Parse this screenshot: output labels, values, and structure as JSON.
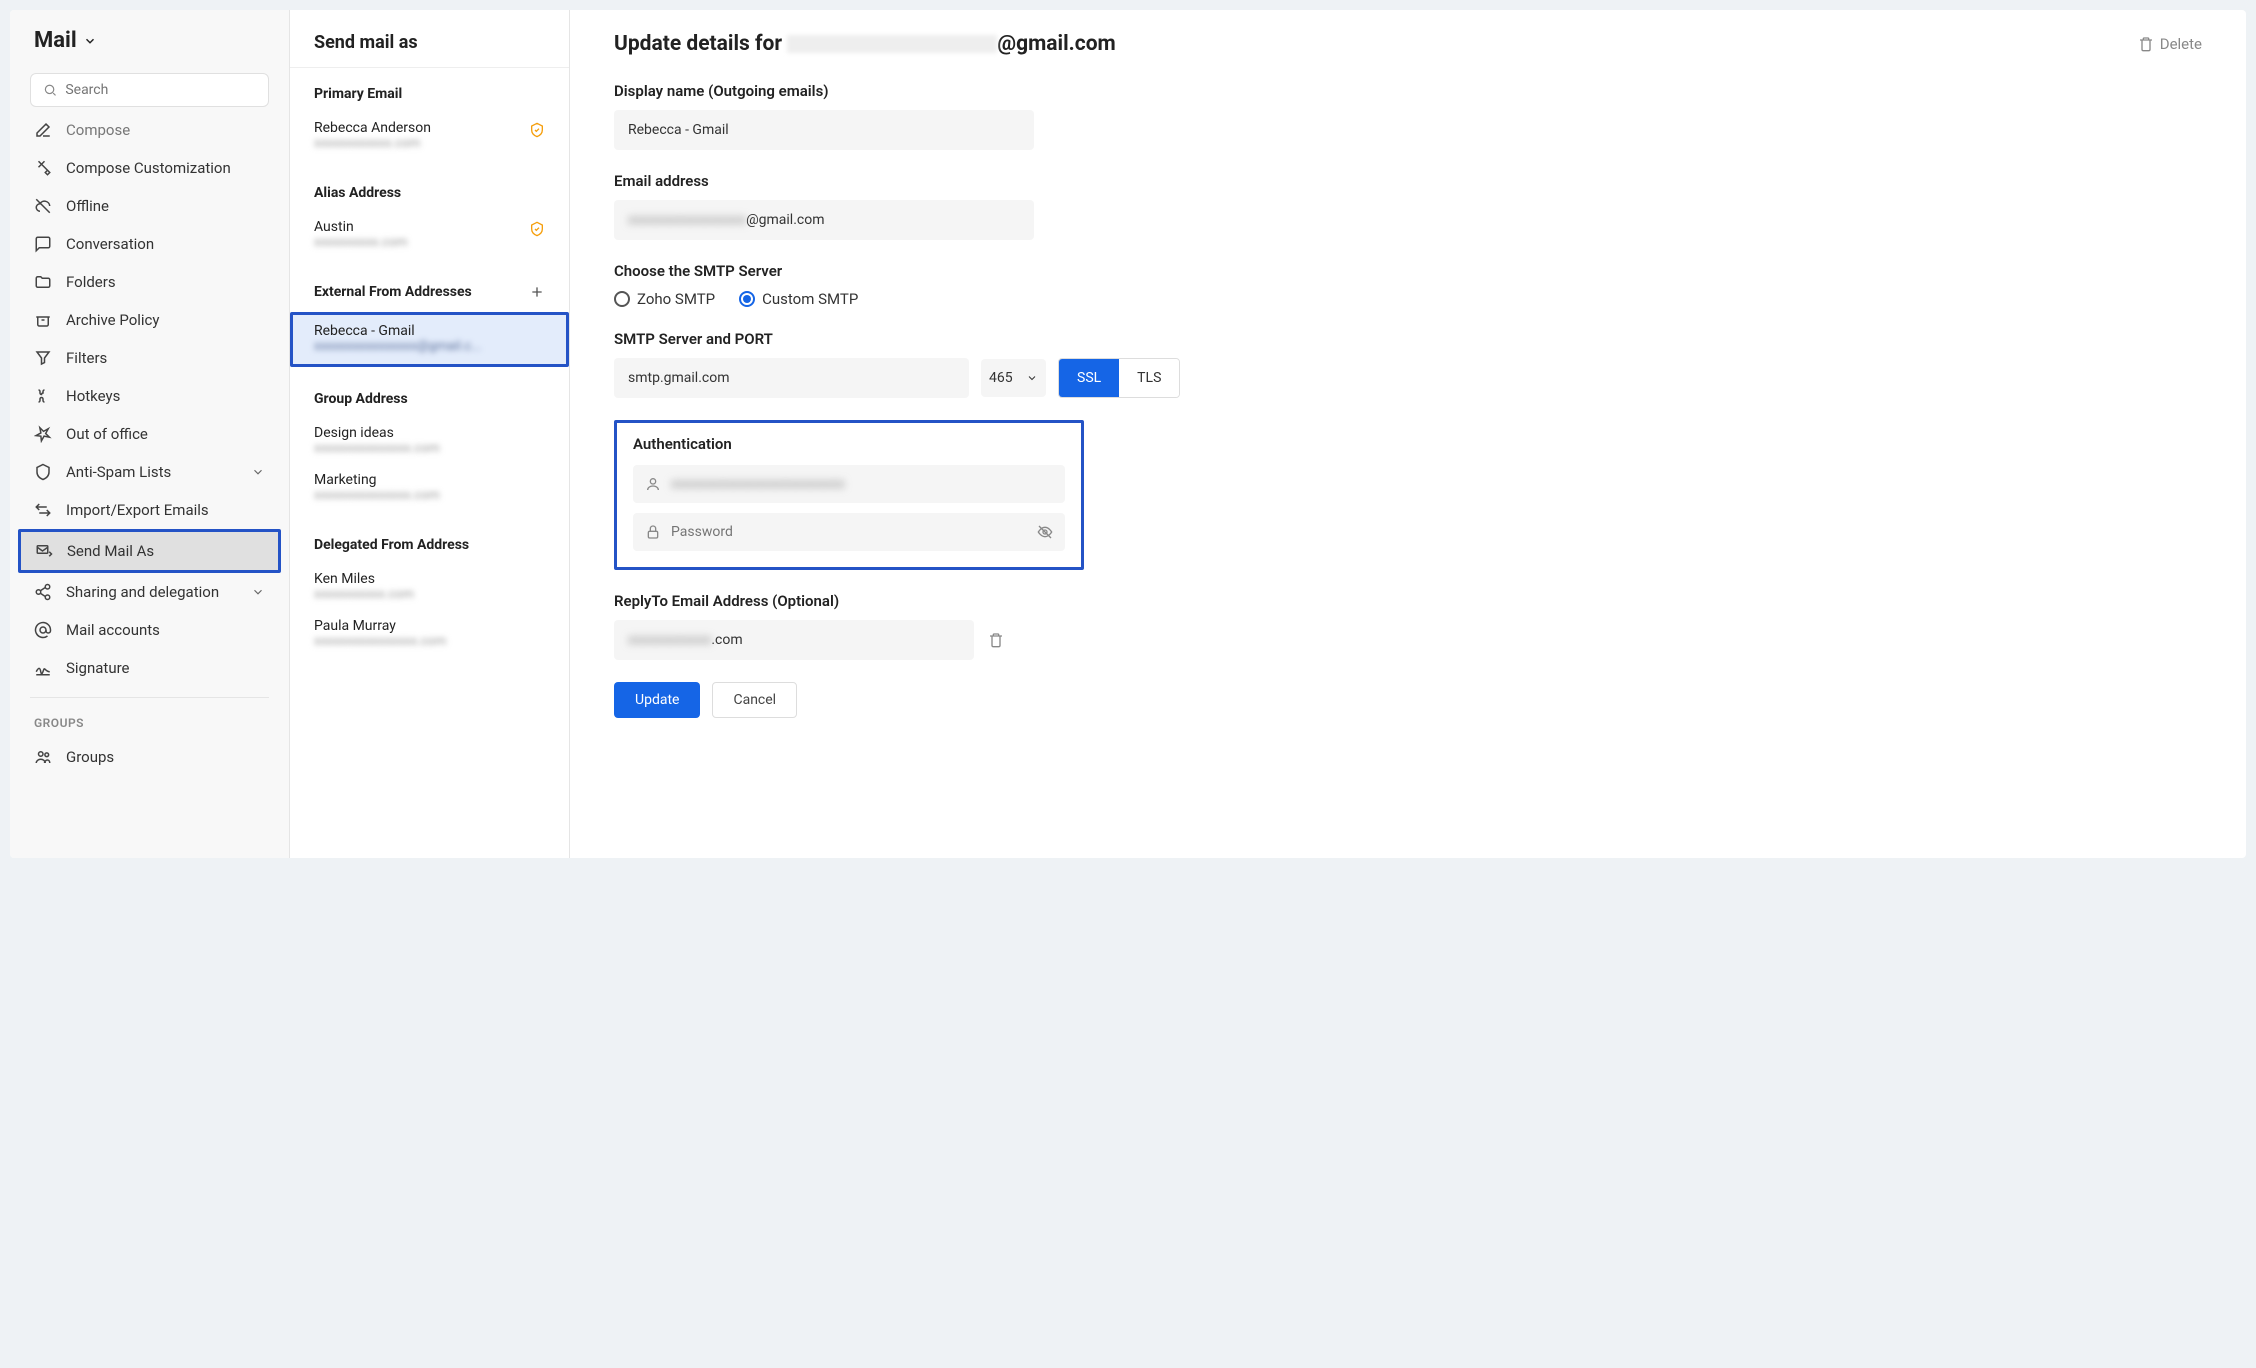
{
  "sidebar": {
    "title": "Mail",
    "search_placeholder": "Search",
    "items": [
      {
        "label": "Compose",
        "icon": "compose"
      },
      {
        "label": "Compose Customization",
        "icon": "customize"
      },
      {
        "label": "Offline",
        "icon": "cloud-off"
      },
      {
        "label": "Conversation",
        "icon": "chat"
      },
      {
        "label": "Folders",
        "icon": "folder"
      },
      {
        "label": "Archive Policy",
        "icon": "archive"
      },
      {
        "label": "Filters",
        "icon": "filter"
      },
      {
        "label": "Hotkeys",
        "icon": "keyboard"
      },
      {
        "label": "Out of office",
        "icon": "plane"
      },
      {
        "label": "Anti-Spam Lists",
        "icon": "shield",
        "chevron": true
      },
      {
        "label": "Import/Export Emails",
        "icon": "transfer"
      },
      {
        "label": "Send Mail As",
        "icon": "send-as",
        "active": true
      },
      {
        "label": "Sharing and delegation",
        "icon": "share",
        "chevron": true
      },
      {
        "label": "Mail accounts",
        "icon": "at"
      },
      {
        "label": "Signature",
        "icon": "signature"
      }
    ],
    "section_label": "GROUPS",
    "groups_label": "Groups"
  },
  "mid": {
    "title": "Send mail as",
    "sections": {
      "primary": {
        "title": "Primary Email",
        "items": [
          {
            "name": "Rebecca Anderson",
            "email_suffix": ".com",
            "verified": true
          }
        ]
      },
      "alias": {
        "title": "Alias Address",
        "items": [
          {
            "name": "Austin",
            "email_suffix": ".com",
            "verified": true
          }
        ]
      },
      "external": {
        "title": "External From Addresses",
        "add": true,
        "items": [
          {
            "name": "Rebecca - Gmail",
            "email_suffix": "@gmail.c...",
            "selected": true
          }
        ]
      },
      "group": {
        "title": "Group Address",
        "items": [
          {
            "name": "Design ideas",
            "email_suffix": ".com"
          },
          {
            "name": "Marketing",
            "email_suffix": ".com"
          }
        ]
      },
      "delegated": {
        "title": "Delegated From Address",
        "items": [
          {
            "name": "Ken Miles",
            "email_suffix": ".com"
          },
          {
            "name": "Paula Murray",
            "email_suffix": ".com"
          }
        ]
      }
    }
  },
  "detail": {
    "title_prefix": "Update details for ",
    "title_suffix": "@gmail.com",
    "delete_label": "Delete",
    "fields": {
      "display_name": {
        "label": "Display name (Outgoing emails)",
        "value": "Rebecca - Gmail"
      },
      "email": {
        "label": "Email address",
        "suffix": "@gmail.com"
      },
      "smtp_choice": {
        "label": "Choose the SMTP Server",
        "options": [
          "Zoho SMTP",
          "Custom SMTP"
        ],
        "selected": 1
      },
      "smtp_server": {
        "label": "SMTP Server and PORT",
        "value": "smtp.gmail.com",
        "port": "465",
        "encryption": [
          "SSL",
          "TLS"
        ],
        "enc_selected": 0
      },
      "auth": {
        "label": "Authentication",
        "password_placeholder": "Password"
      },
      "replyto": {
        "label": "ReplyTo Email Address (Optional)",
        "suffix": ".com"
      }
    },
    "buttons": {
      "update": "Update",
      "cancel": "Cancel"
    }
  }
}
